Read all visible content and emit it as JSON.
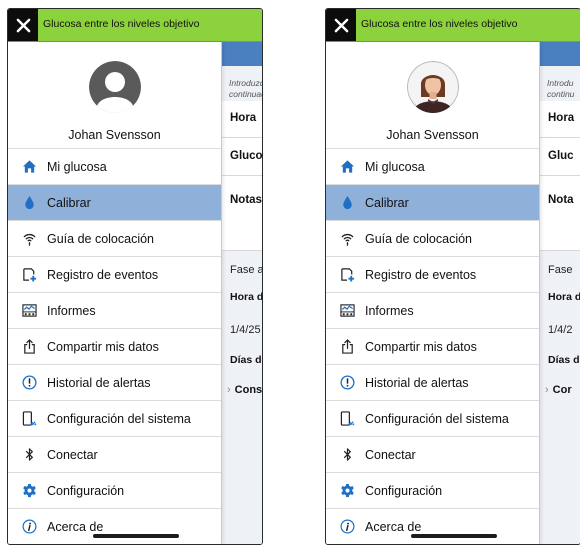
{
  "header": {
    "title": "Glucosa entre los niveles objetivo"
  },
  "user": {
    "name": "Johan Svensson"
  },
  "menu": {
    "items": [
      {
        "label": "Mi glucosa",
        "icon": "home-icon"
      },
      {
        "label": "Calibrar",
        "icon": "drop-icon",
        "active": true
      },
      {
        "label": "Guía de colocación",
        "icon": "signal-icon"
      },
      {
        "label": "Registro de eventos",
        "icon": "add-event-icon"
      },
      {
        "label": "Informes",
        "icon": "reports-icon"
      },
      {
        "label": "Compartir mis datos",
        "icon": "share-icon"
      },
      {
        "label": "Historial de alertas",
        "icon": "alert-icon"
      },
      {
        "label": "Configuración del sistema",
        "icon": "system-settings-icon"
      },
      {
        "label": "Conectar",
        "icon": "bluetooth-icon"
      },
      {
        "label": "Configuración",
        "icon": "gear-icon"
      },
      {
        "label": "Acerca de",
        "icon": "info-icon"
      }
    ]
  },
  "background_left": {
    "intro_line1": "Introduzc",
    "intro_line2": "continuac",
    "row_hora": "Hora",
    "row_glucosa": "Glucos",
    "row_notas": "Notas",
    "fase": "Fase a",
    "hora_de": "Hora de",
    "date": "1/4/25",
    "dias_de": "Días de",
    "cons": "Cons"
  },
  "background_right": {
    "intro_line1": "Introdu",
    "intro_line2": "continu",
    "row_hora": "Hora",
    "row_glucosa": "Gluc",
    "row_notas": "Nota",
    "fase": "Fase",
    "hora_de": "Hora d",
    "date": "1/4/2",
    "dias_de": "Días d",
    "cons": "Cor"
  },
  "colors": {
    "header_bar": "#8cd23c",
    "active_item": "#8fb0d9",
    "icon_blue": "#1f6fc4",
    "content_header": "#4a7fc0"
  }
}
